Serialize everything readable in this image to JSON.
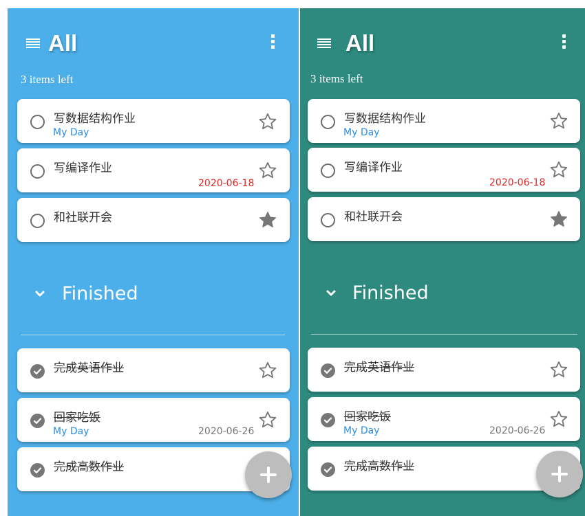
{
  "themes": {
    "left": {
      "background": "#4dafe9"
    },
    "right": {
      "background": "#2e8a7f"
    }
  },
  "header": {
    "title": "All",
    "items_left": "3 items left",
    "menu_icon": "hamburger-list-icon",
    "more_icon": "more-vertical-icon"
  },
  "tasks": [
    {
      "name": "写数据结构作业",
      "tag": "My Day",
      "due": "",
      "starred": false
    },
    {
      "name": "写编译作业",
      "tag": "",
      "due": "2020-06-18",
      "starred": false
    },
    {
      "name": "和社联开会",
      "tag": "",
      "due": "",
      "starred": true
    }
  ],
  "finished_section": {
    "label": "Finished",
    "icon": "chevron-down-icon"
  },
  "finished_tasks": [
    {
      "name": "完成英语作业",
      "tag": "",
      "due": "",
      "starred": false
    },
    {
      "name": "回家吃饭",
      "tag": "My Day",
      "due": "2020-06-26",
      "starred": false
    },
    {
      "name": "完成高数作业",
      "tag": "",
      "due": "",
      "starred": false
    }
  ],
  "fab": {
    "icon": "plus-icon"
  },
  "colors": {
    "due_overdue": "#e02525",
    "tag_blue": "#2d8de0",
    "fab": "#bdbdbd"
  }
}
